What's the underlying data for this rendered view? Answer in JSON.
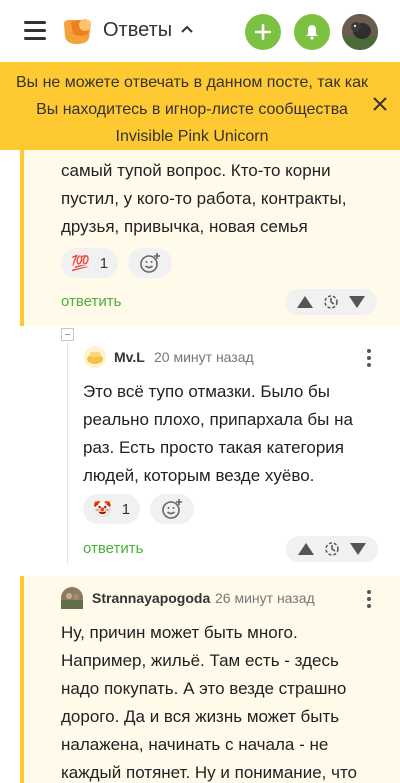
{
  "header": {
    "brand": "Ответы",
    "icons": {
      "menu": "menu-icon",
      "logo": "logo-icon",
      "expand": "chevron-up-icon",
      "add": "plus-icon",
      "notifications": "bell-icon",
      "avatar": "user-avatar"
    }
  },
  "banner": {
    "line1": "Вы не можете отвечать в данном посте, так как",
    "line2": "Вы находитесь в игнор-листе сообщества",
    "line3": "Invisible Pink Unicorn",
    "bg_color": "#ffc931"
  },
  "comments": [
    {
      "text_lines": [
        "самый тупой вопрос. Кто-то корни",
        "пустил, у кого-то работа, контракты,",
        "друзья, привычка, новая семья"
      ],
      "reaction": {
        "emoji": "💯",
        "count": "1"
      },
      "reply_label": "ответить"
    },
    {
      "username": "Mv.L",
      "time": "20 минут назад",
      "text_lines": [
        "Это всё тупо отмазки. Было бы",
        "реально плохо, припархала бы на",
        "раз. Есть просто такая категория",
        "людей, которым везде хуёво."
      ],
      "reaction": {
        "emoji": "🤡",
        "count": "1"
      },
      "reply_label": "ответить"
    },
    {
      "username": "Strannayapogoda",
      "time": "26 минут назад",
      "text_lines": [
        "Ну, причин может быть много.",
        "Например, жильё. Там есть - здесь",
        "надо покупать. А это везде страшно",
        "дорого. Да и вся жизнь может быть",
        "налажена, начинать с начала - не",
        "каждый потянет. Ну и понимание, что"
      ]
    }
  ],
  "colors": {
    "accent_green": "#7dc143",
    "highlight": "#fffaea",
    "reply_green": "#4caf3a"
  }
}
